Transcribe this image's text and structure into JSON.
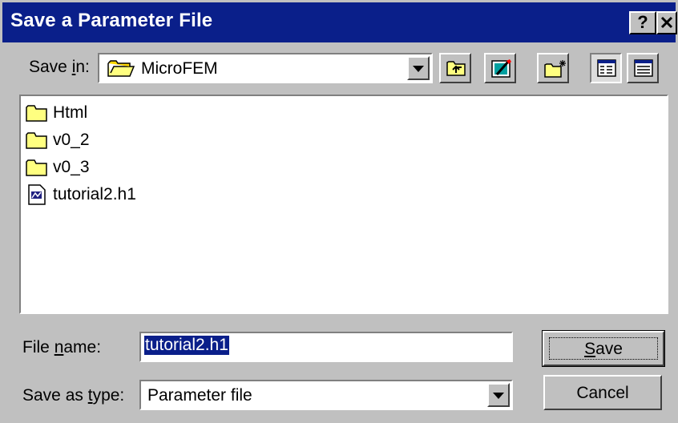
{
  "window": {
    "title": "Save a Parameter File",
    "help_button": "?",
    "close_button": "✕"
  },
  "save_in": {
    "label_before": "Save ",
    "label_accel": "i",
    "label_after": "n:",
    "value": "MicroFEM"
  },
  "toolbar": [
    "up-one-level",
    "go-to-desktop",
    "create-new-folder",
    "list-view",
    "details-view"
  ],
  "files": [
    {
      "name": "Html",
      "type": "folder"
    },
    {
      "name": "v0_2",
      "type": "folder"
    },
    {
      "name": "v0_3",
      "type": "folder"
    },
    {
      "name": "tutorial2.h1",
      "type": "file"
    }
  ],
  "file_name": {
    "label_before": "File ",
    "label_accel": "n",
    "label_after": "ame:",
    "value": "tutorial2.h1"
  },
  "save_as_type": {
    "label_before": "Save as ",
    "label_accel": "t",
    "label_after": "ype:",
    "value": "Parameter file"
  },
  "buttons": {
    "save_accel": "S",
    "save_rest": "ave",
    "cancel": "Cancel"
  }
}
